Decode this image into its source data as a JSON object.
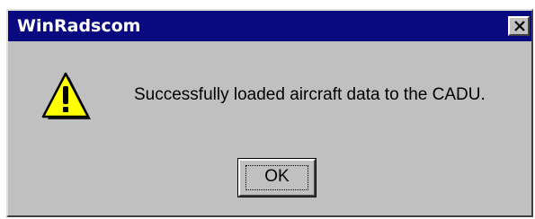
{
  "window": {
    "title": "WinRadscom",
    "close_icon": "close-icon",
    "colors": {
      "titlebar": "#0a0a80",
      "face": "#c0c0c0"
    }
  },
  "dialog": {
    "icon": "warning-icon",
    "message": "Successfully loaded aircraft data to the CADU.",
    "ok_label": "OK"
  }
}
